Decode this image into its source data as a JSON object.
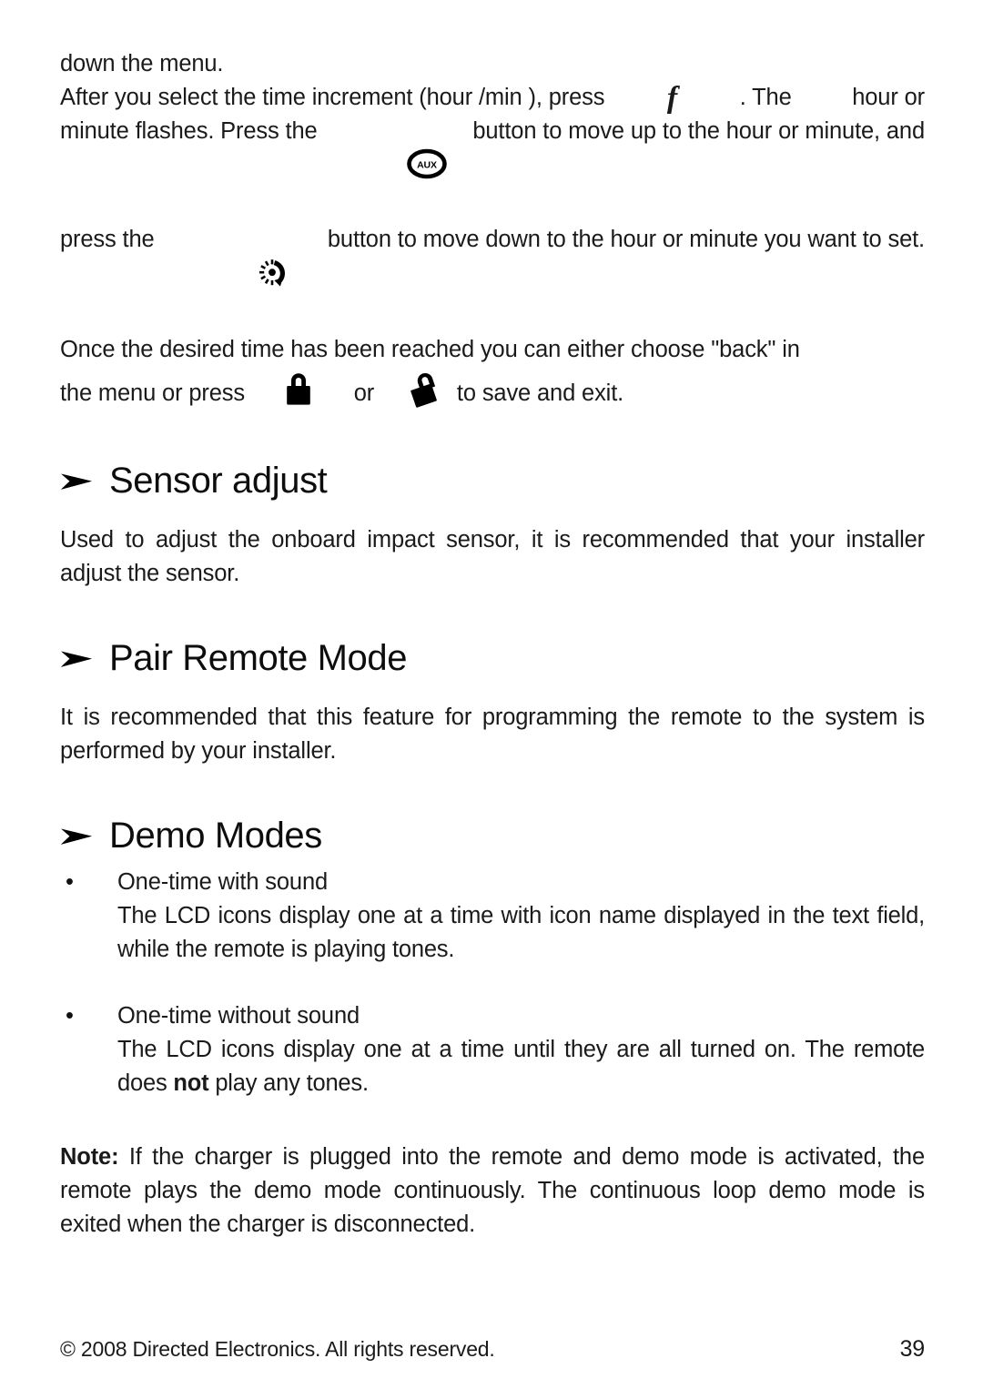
{
  "document": {
    "title": "Directed Electronics Remote Manual",
    "page_number": "39",
    "background_color": "#ffffff",
    "text_color": "#1a1a1a"
  },
  "intro_paragraph": {
    "line1": "down the menu.",
    "line2_a": "After you select the time increment (hour /min ), press",
    "line2_icon": "f-symbol",
    "line2_b": ". The",
    "line2_c": "hour or",
    "line3_a": "minute flashes. Press the",
    "line3_icon": "aux-button-icon",
    "line3_b": "button to move up to the hour or minute, and",
    "line4_a": "press the",
    "line4_icon": "dial-dimmer-icon",
    "line4_b": "button to move down to the hour or minute you want to set.",
    "line5": "Once the desired time has been reached you can either choose \"back\" in",
    "line6_a": "the menu or press",
    "line6_icon1": "lock-closed-icon",
    "line6_b": "or",
    "line6_icon2": "lock-open-icon",
    "line6_c": "to save and exit."
  },
  "sections": [
    {
      "heading": "Sensor adjust",
      "bullet_glyph": "➛",
      "body": "Used to adjust the onboard impact sensor, it is recommended that your installer adjust the sensor."
    },
    {
      "heading": "Pair Remote Mode",
      "bullet_glyph": "➛",
      "body": "It is recommended that this feature for programming the remote to the system is performed by your installer."
    },
    {
      "heading": "Demo Modes",
      "bullet_glyph": "➛",
      "body": ""
    }
  ],
  "demo_modes": {
    "bullet_glyph": "•",
    "items": [
      {
        "title": "One-time with sound",
        "text": "The LCD icons display one at a time with icon name displayed in the text field, while the remote is playing tones."
      },
      {
        "title": "One-time without sound",
        "text_before": "The LCD icons display one at a time until they are all turned on. The remote does ",
        "text_bold": "not",
        "text_after": " play any tones."
      }
    ]
  },
  "note": {
    "label": "Note:",
    "text": " If the charger is plugged into the remote and demo mode is activated, the remote plays the demo mode continuously. The continuous loop demo mode is exited when the charger is disconnected."
  },
  "footer": {
    "copyright": "© 2008 Directed Electronics. All rights reserved.",
    "page_number": "39"
  },
  "icons": {
    "aux_label": "AUX",
    "f_symbol": "f"
  }
}
